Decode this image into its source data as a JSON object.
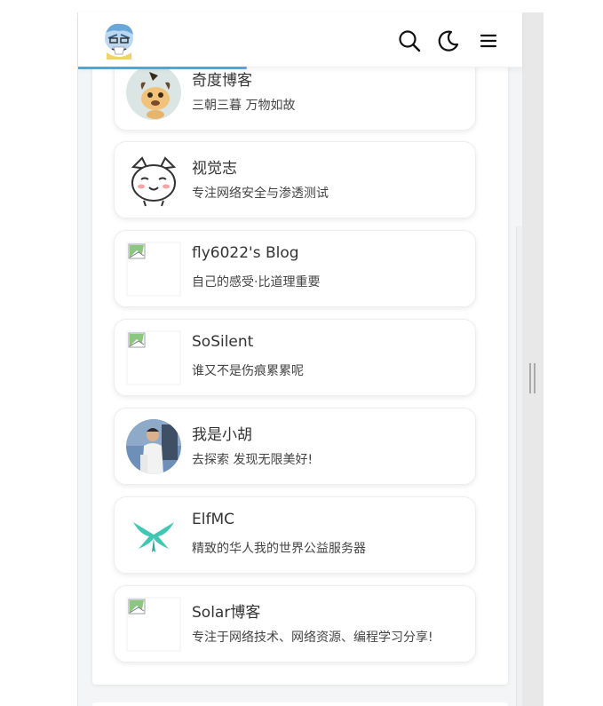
{
  "header": {
    "progress_fraction": 0.38,
    "icons": [
      "site-logo-avatar",
      "search-icon",
      "dark-mode-moon-icon",
      "menu-icon"
    ]
  },
  "links": [
    {
      "name": "奇度博客",
      "desc": "三朝三暮 万物如故",
      "avatar": "dog-avatar"
    },
    {
      "name": "视觉志",
      "desc": "专注网络安全与渗透测试",
      "avatar": "cat-avatar"
    },
    {
      "name": "fly6022's Blog",
      "desc": "自己的感受·比道理重要",
      "avatar": "broken-image"
    },
    {
      "name": "SoSilent",
      "desc": "谁又不是伤痕累累呢",
      "avatar": "broken-image"
    },
    {
      "name": "我是小胡",
      "desc": "去探索 发现无限美好!",
      "avatar": "person-photo"
    },
    {
      "name": "ElfMC",
      "desc": "精致的华人我的世界公益服务器",
      "avatar": "elf-wings-logo"
    },
    {
      "name": "Solar博客",
      "desc": "专注于网络技术、网络资源、编程学习分享!",
      "avatar": "broken-image"
    }
  ],
  "colors": {
    "accent": "#4aa8dc",
    "elf": "#3fc7b4",
    "text": "#333333"
  }
}
